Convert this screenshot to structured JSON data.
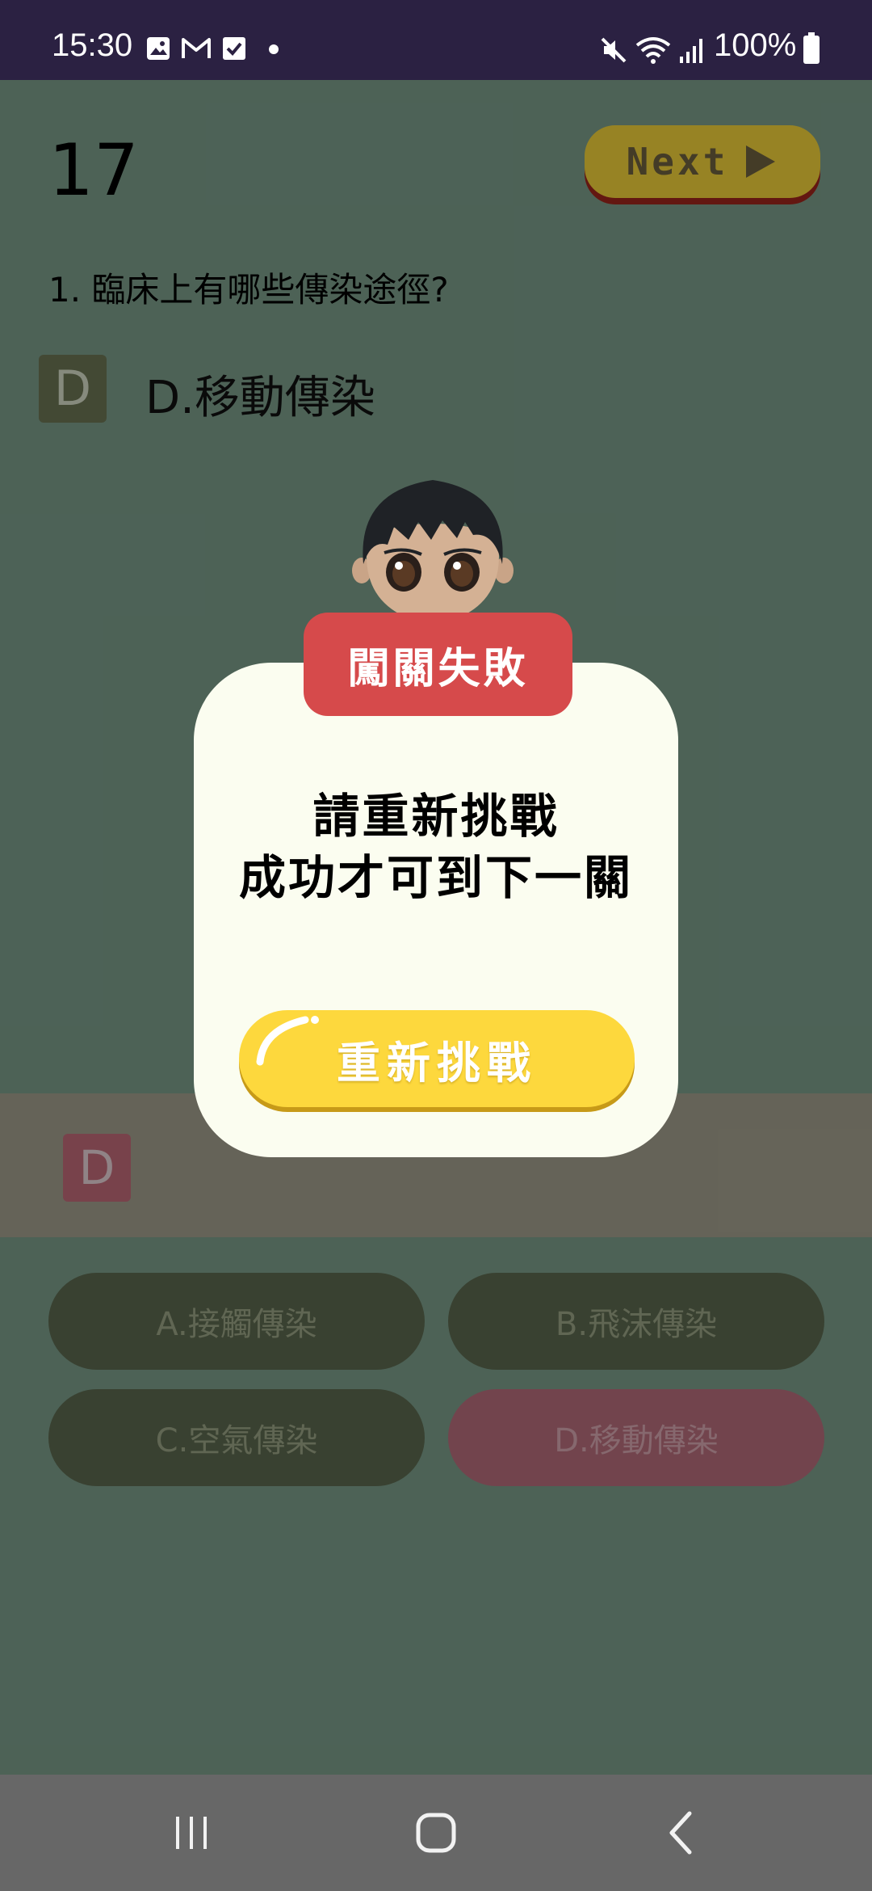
{
  "status_bar": {
    "time": "15:30",
    "battery_text": "100%",
    "icons_left": [
      "image-icon",
      "gmail-icon",
      "checkbox-icon",
      "dot-icon"
    ],
    "icons_right": [
      "mute-icon",
      "wifi-icon",
      "signal-icon",
      "battery-icon"
    ]
  },
  "quiz": {
    "question_number": "17",
    "next_label": "Next",
    "question_text": "1. 臨床上有哪些傳染途徑?",
    "selected_badge": "D",
    "selected_answer": "D.移動傳染",
    "strip_badge": "D",
    "options": [
      {
        "label": "A.接觸傳染",
        "state": "normal"
      },
      {
        "label": "B.飛沫傳染",
        "state": "normal"
      },
      {
        "label": "C.空氣傳染",
        "state": "normal"
      },
      {
        "label": "D.移動傳染",
        "state": "wrong"
      }
    ]
  },
  "dialog": {
    "title": "闖關失敗",
    "message_line1": "請重新挑戰",
    "message_line2": "成功才可到下一關",
    "retry_label": "重新挑戰"
  },
  "colors": {
    "status_bar": "#2b2142",
    "page_bg": "#7c9e8c",
    "title_red": "#d64a4b",
    "button_yellow": "#fdd83d",
    "dialog_bg": "#fbfdf0"
  },
  "nav_bar": {
    "buttons": [
      "recent-apps-icon",
      "home-icon",
      "back-icon"
    ]
  }
}
